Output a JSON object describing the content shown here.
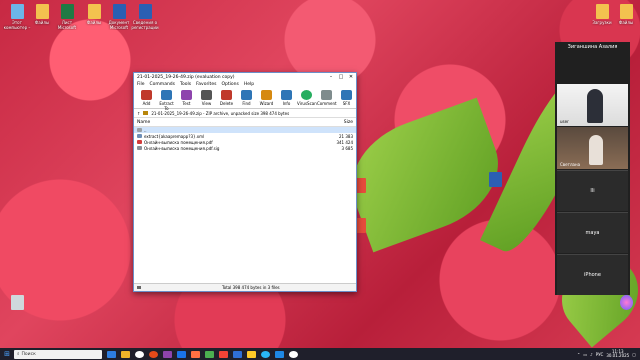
{
  "desktop_icons": [
    {
      "label": "Этот компьютер – Ярлык",
      "color": "#6cb6e8"
    },
    {
      "label": "Файлы",
      "color": "#f3c24f"
    },
    {
      "label": "Лист Microsoft Excel",
      "color": "#1f7a44"
    },
    {
      "label": "Файлы",
      "color": "#f3c24f"
    },
    {
      "label": "Документ Microsoft Word",
      "color": "#2b5fb3"
    },
    {
      "label": "Сведения о регистрации",
      "color": "#2b5fb3"
    },
    {
      "label": "Загрузки",
      "color": "#f3c24f"
    },
    {
      "label": "Файлы",
      "color": "#f3c24f"
    }
  ],
  "winrar": {
    "title": "21-01-2025_19-26-49.zip (evaluation copy)",
    "menu": [
      "File",
      "Commands",
      "Tools",
      "Favorites",
      "Options",
      "Help"
    ],
    "toolbar": [
      {
        "label": "Add",
        "color": "#c0392b"
      },
      {
        "label": "Extract To",
        "color": "#2e75b6"
      },
      {
        "label": "Test",
        "color": "#8e44ad"
      },
      {
        "label": "View",
        "color": "#555555"
      },
      {
        "label": "Delete",
        "color": "#c0392b"
      },
      {
        "label": "Find",
        "color": "#2e75b6"
      },
      {
        "label": "Wizard",
        "color": "#d68910"
      },
      {
        "label": "Info",
        "color": "#2e75b6"
      },
      {
        "label": "VirusScan",
        "color": "#27ae60"
      },
      {
        "label": "Comment",
        "color": "#7f8c8d"
      },
      {
        "label": "SFX",
        "color": "#2e75b6"
      }
    ],
    "path": "21-01-2025_19-26-49.zip - ZIP archive, unpacked size 398 474 bytes",
    "columns": {
      "name": "Name",
      "size": "Size"
    },
    "files": [
      {
        "name": "..",
        "size": "",
        "icon_color": "#9aa0a6"
      },
      {
        "name": "extract{akaapremapp?3}.xml",
        "size": "21 383",
        "icon_color": "#6e8fb8"
      },
      {
        "name": "Онлайн-выписка помещения.pdf",
        "size": "341 424",
        "icon_color": "#d23b3b"
      },
      {
        "name": "Онлайн-выписка помещения.pdf.sig",
        "size": "3 685",
        "icon_color": "#8a8f98"
      }
    ],
    "status_left": "",
    "status_right": "Total 398 474 bytes in 3 files"
  },
  "call": {
    "title": "Зиганшина Азалия",
    "tiles": [
      {
        "name": "user",
        "kind": "video"
      },
      {
        "name": "Светлана",
        "kind": "video"
      },
      {
        "name": "",
        "label": "Ili",
        "kind": "text"
      },
      {
        "name": "",
        "label": "maya",
        "kind": "text"
      },
      {
        "name": "",
        "label": "iPhone",
        "kind": "text"
      }
    ]
  },
  "taskbar": {
    "search_placeholder": "Поиск",
    "apps": [
      "#2d7de0",
      "#f0b429",
      "#ffffff",
      "#e64a19",
      "#8e44ad",
      "#1a73e8",
      "#ff7043",
      "#4caf50",
      "#f44336",
      "#2f6fd6",
      "#ffca28",
      "#29b6f6",
      "#1e88e5",
      "#ffffff"
    ],
    "lang": "РУС",
    "time": "11:13",
    "date": "30.01.2025"
  }
}
